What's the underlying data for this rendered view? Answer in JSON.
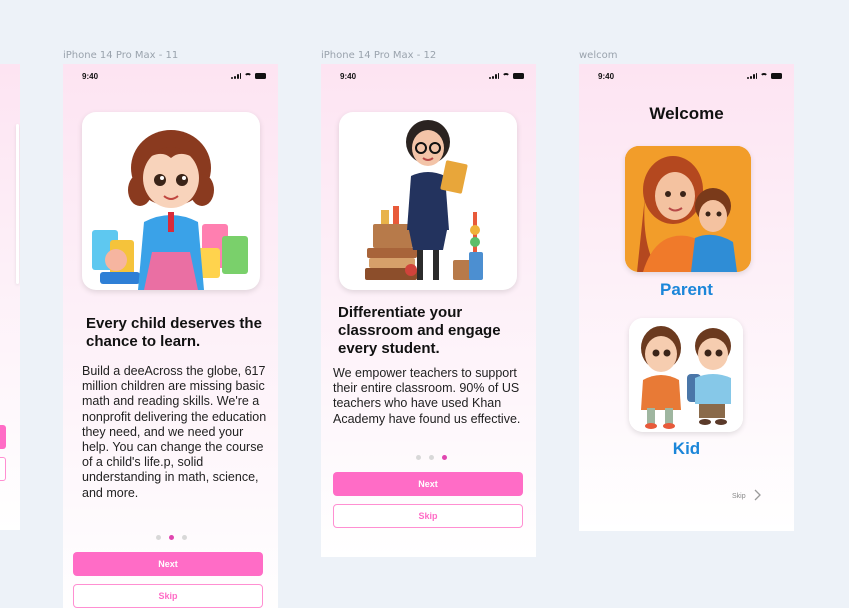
{
  "frames": {
    "f11": "iPhone 14 Pro Max - 11",
    "f12": "iPhone 14 Pro Max - 12",
    "welcome": "welcom"
  },
  "status": {
    "time": "9:40"
  },
  "screen11": {
    "title": "Every child deserves the chance to learn.",
    "body": "Build a deeAcross the globe, 617 million children are missing basic math and reading skills. We're a nonprofit delivering the education they need, and we need your help. You can change the course of a child's life.p, solid understanding in math, science, and more.",
    "page_index": 2,
    "page_total": 3,
    "next_label": "Next",
    "skip_label": "Skip"
  },
  "screen12": {
    "title": "Differentiate your classroom and engage every student.",
    "body": "We empower teachers to support their entire classroom. 90% of US teachers who have used Khan Academy have found us effective.",
    "page_index": 3,
    "page_total": 3,
    "next_label": "Next",
    "skip_label": "Skip"
  },
  "welcome": {
    "title": "Welcome",
    "parent_label": "Parent",
    "kid_label": "Kid",
    "skip_label": "Skip"
  },
  "colors": {
    "accent_pink": "#ff6cc6",
    "kid_blue": "#1b86d9",
    "active_dot": "#e046b0"
  }
}
